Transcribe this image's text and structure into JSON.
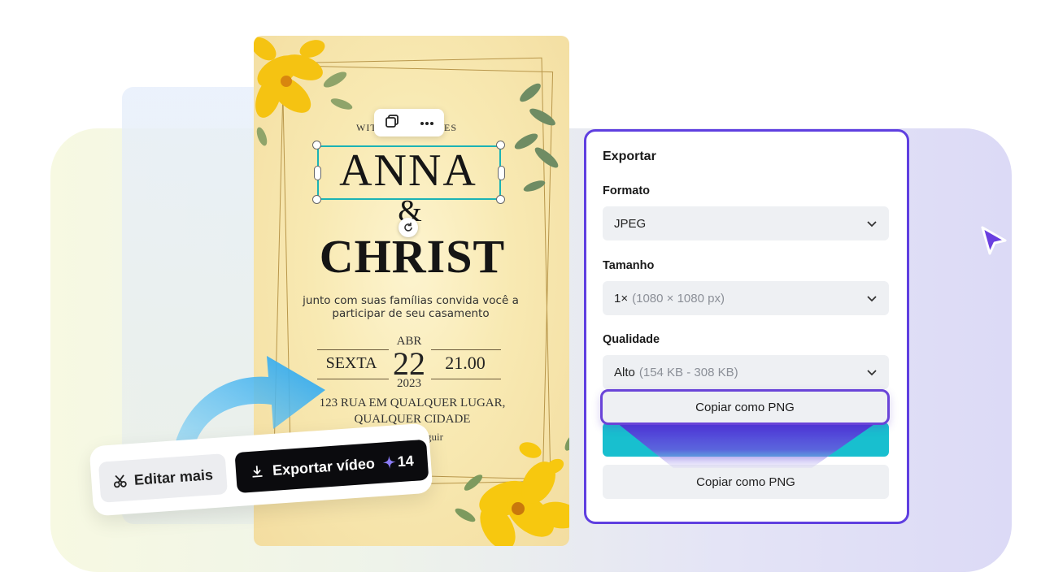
{
  "invitation": {
    "top_text_left": "WIT",
    "top_text_right": "ES",
    "name_first": "ANNA",
    "ampersand": "&",
    "name_second": "CHRIST",
    "invite_line": "junto com suas famílias convida você a participar de seu casamento",
    "month": "ABR",
    "day": "22",
    "year": "2023",
    "weekday": "SEXTA",
    "time": "21.00",
    "address": "123 RUA EM QUALQUER LUGAR, QUALQUER CIDADE",
    "trailing_text": "guir"
  },
  "actions": {
    "edit_label": "Editar mais",
    "export_label": "Exportar vídeo",
    "credits": "14"
  },
  "export_panel": {
    "title": "Exportar",
    "format_label": "Formato",
    "format_value": "JPEG",
    "size_label": "Tamanho",
    "size_value": "1×",
    "size_detail": "(1080 × 1080 px)",
    "quality_label": "Qualidade",
    "quality_value": "Alto",
    "quality_detail": "(154 KB - 308 KB)",
    "copy_png_highlight": "Copiar como PNG",
    "copy_png": "Copiar como PNG"
  },
  "colors": {
    "accent": "#5f3fe0",
    "teal": "#18bfcf",
    "dark_button": "#0b0b0e"
  }
}
